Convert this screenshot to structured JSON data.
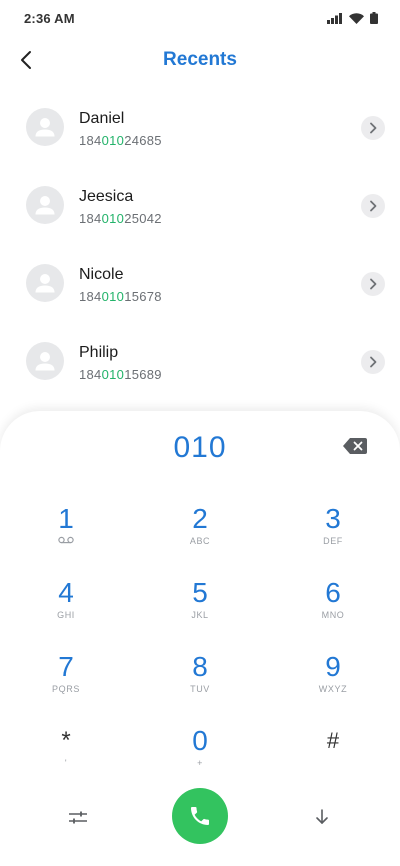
{
  "status_bar": {
    "time": "2:36 AM"
  },
  "header": {
    "title": "Recents"
  },
  "contacts": [
    {
      "name": "Daniel",
      "number_prefix": "184",
      "number_match": "010",
      "number_suffix": "24685"
    },
    {
      "name": "Jeesica",
      "number_prefix": "184",
      "number_match": "010",
      "number_suffix": "25042"
    },
    {
      "name": "Nicole",
      "number_prefix": "184",
      "number_match": "010",
      "number_suffix": "15678"
    },
    {
      "name": "Philip",
      "number_prefix": "184",
      "number_match": "010",
      "number_suffix": "15689"
    }
  ],
  "dialpad": {
    "input_value": "010",
    "keys": [
      {
        "digit": "1",
        "letters": "",
        "icon": "voicemail-icon"
      },
      {
        "digit": "2",
        "letters": "ABC"
      },
      {
        "digit": "3",
        "letters": "DEF"
      },
      {
        "digit": "4",
        "letters": "GHI"
      },
      {
        "digit": "5",
        "letters": "JKL"
      },
      {
        "digit": "6",
        "letters": "MNO"
      },
      {
        "digit": "7",
        "letters": "PQRS"
      },
      {
        "digit": "8",
        "letters": "TUV"
      },
      {
        "digit": "9",
        "letters": "WXYZ"
      },
      {
        "digit": "*",
        "letters": "'"
      },
      {
        "digit": "0",
        "letters": "+"
      },
      {
        "digit": "#",
        "letters": ""
      }
    ]
  },
  "colors": {
    "accent": "#2278d4",
    "match_highlight": "#23b36a",
    "call_button": "#33c35f"
  },
  "icons": {
    "back": "chevron-left-icon",
    "row_action": "chevron-right-icon",
    "backspace": "backspace-icon",
    "settings": "sliders-icon",
    "collapse": "arrow-down-icon",
    "call": "phone-icon"
  }
}
